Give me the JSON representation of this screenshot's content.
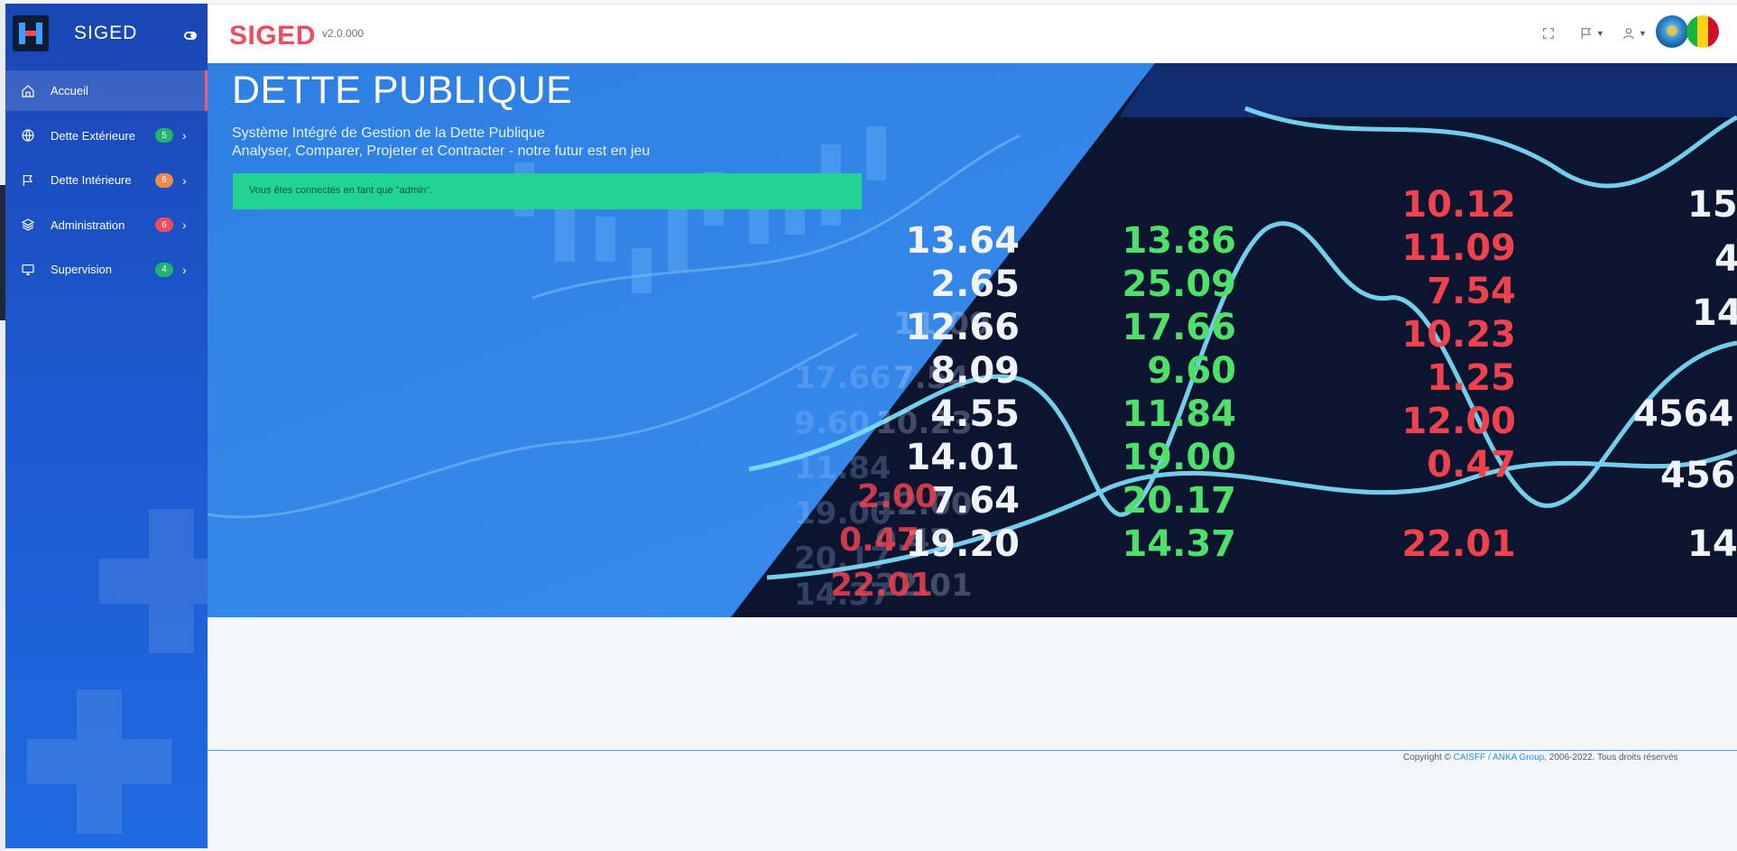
{
  "sidebar": {
    "brand": "SIGED",
    "items": [
      {
        "label": "Accueil",
        "icon": "home-icon",
        "badge": null
      },
      {
        "label": "Dette Extérieure",
        "icon": "globe-icon",
        "badge": "5",
        "badge_color": "#1fb56f"
      },
      {
        "label": "Dette Intérieure",
        "icon": "flag-icon",
        "badge": "6",
        "badge_color": "#f08a4b"
      },
      {
        "label": "Administration",
        "icon": "layers-icon",
        "badge": "6",
        "badge_color": "#ef4b5d"
      },
      {
        "label": "Supervision",
        "icon": "monitor-icon",
        "badge": "4",
        "badge_color": "#1fb56f"
      }
    ]
  },
  "header": {
    "title": "SIGED",
    "version": "v2.0.000",
    "icons": [
      "fullscreen-icon",
      "flag-icon",
      "user-icon"
    ]
  },
  "banner": {
    "title": "DETTE PUBLIQUE",
    "subtitle_line1": "Système Intégré de Gestion de la Dette Publique",
    "subtitle_line2": "Analyser, Comparer, Projeter et Contracter - notre futur est en jeu",
    "alert": "Vous êtes connectés en tant que \"admin\".",
    "ticker_left": [
      "13.64",
      "2.65",
      "12.66",
      "8.09",
      "4.55",
      "14.01",
      "7.64",
      "19.20"
    ],
    "ticker_mid": [
      "13.86",
      "25.09",
      "17.66",
      "9.60",
      "11.84",
      "19.00",
      "20.17",
      "14.37"
    ],
    "ticker_right": [
      "10.12",
      "11.09",
      "7.54",
      "10.23",
      "1.25",
      "12.00",
      "0.47",
      "22.01"
    ],
    "ticker_far": [
      "15",
      "4",
      "14",
      "4564",
      "456",
      "14"
    ]
  },
  "footer": {
    "prefix": "Copyright ©",
    "link": "CAISFF / ANKA Group",
    "suffix": ", 2006-2022. Tous droits réservés"
  },
  "colors": {
    "brand_red": "#ef4b5d",
    "sidebar_blue": "#1d58cf",
    "alert_green": "#22d48f",
    "flag_green": "#14b53a",
    "flag_yellow": "#fcd116",
    "flag_red": "#ce1126"
  }
}
